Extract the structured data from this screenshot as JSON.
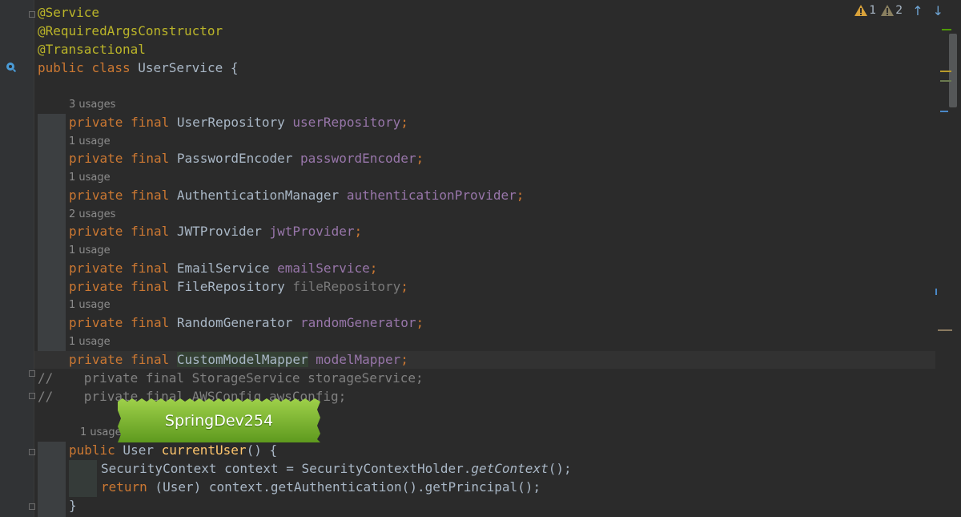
{
  "status": {
    "error_count": "1",
    "warning_count": "2",
    "error_color": "#d9a23a",
    "warning_color": "#b0a070",
    "up_arrow": "↑",
    "down_arrow": "↓"
  },
  "code": {
    "ann_service": "@Service",
    "ann_ctor": "@RequiredArgsConstructor",
    "ann_tx": "@Transactional",
    "class_public": "public",
    "class_kw": "class",
    "class_name": " UserService {",
    "fields": [
      {
        "usage": "3 usages",
        "type": "UserRepository",
        "name": "userRepository"
      },
      {
        "usage": "1 usage",
        "type": "PasswordEncoder",
        "name": "passwordEncoder"
      },
      {
        "usage": "1 usage",
        "type": "AuthenticationManager",
        "name": "authenticationProvider"
      },
      {
        "usage": "2 usages",
        "type": "JWTProvider",
        "name": "jwtProvider"
      },
      {
        "usage": "1 usage",
        "type": "EmailService",
        "name": "emailService"
      },
      {
        "usage": "",
        "type": "FileRepository",
        "name": "fileRepository"
      },
      {
        "usage": "1 usage",
        "type": "RandomGenerator",
        "name": "randomGenerator"
      },
      {
        "usage": "1 usage",
        "type": "CustomModelMapper",
        "name": "modelMapper"
      }
    ],
    "private_kw": "private",
    "final_kw": "final",
    "semicolon": ";",
    "comment1": "//    private final StorageService storageService;",
    "comment2": "//    private final AWSConfig awsConfig;",
    "method_usage": "1 usage",
    "method_public": "public",
    "method_return": " User ",
    "method_name": "currentUser",
    "method_rest": "() {",
    "body1_a": "SecurityContext context = SecurityContextHolder.",
    "body1_b": "getContext",
    "body1_c": "();",
    "body2_kw": "return",
    "body2_rest": " (User) context.getAuthentication().getPrincipal();",
    "close_brace": "}"
  },
  "watermark": {
    "text": "SpringDev254",
    "color": "#7fb82a"
  }
}
